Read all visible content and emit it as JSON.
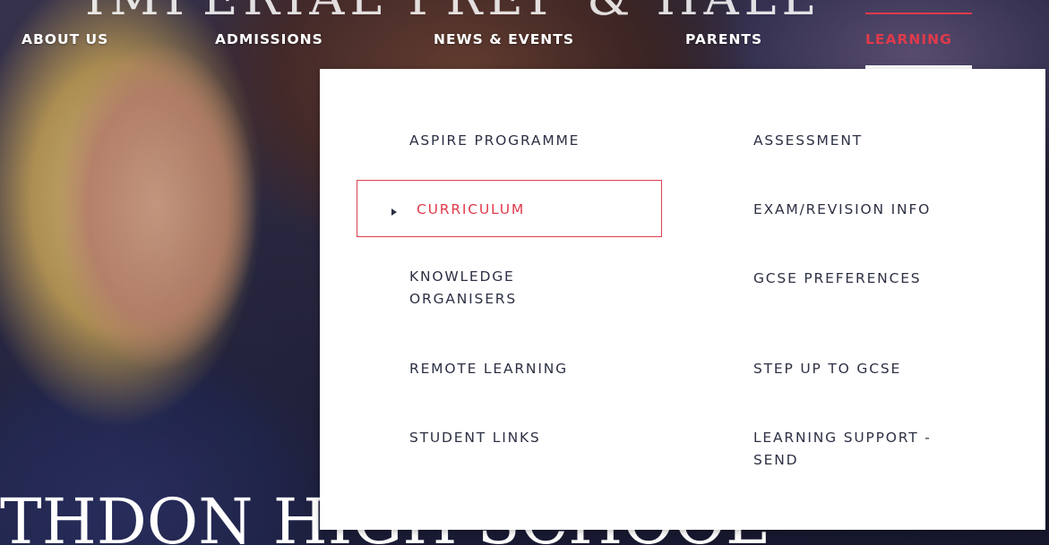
{
  "hero": {
    "title_top": "IMPERIAL PREP & HALL",
    "title_bottom": "THDON HIGH SCHOOL"
  },
  "nav": {
    "items": [
      {
        "label": "ABOUT US"
      },
      {
        "label": "ADMISSIONS"
      },
      {
        "label": "NEWS & EVENTS"
      },
      {
        "label": "PARENTS"
      },
      {
        "label": "LEARNING"
      }
    ],
    "active_item": "LEARNING",
    "accent_color": "#e03a4b"
  },
  "dropdown": {
    "left_column": [
      {
        "label": "ASPIRE PROGRAMME"
      },
      {
        "label": "CURRICULUM"
      },
      {
        "label": "KNOWLEDGE",
        "label2": "ORGANISERS"
      },
      {
        "label": "REMOTE LEARNING"
      },
      {
        "label": "STUDENT LINKS"
      }
    ],
    "right_column": [
      {
        "label": "ASSESSMENT"
      },
      {
        "label": "EXAM/REVISION INFO"
      },
      {
        "label": "GCSE PREFERENCES"
      },
      {
        "label": "STEP UP TO GCSE"
      },
      {
        "label": "LEARNING SUPPORT -",
        "label2": "SEND"
      }
    ],
    "current_item": "CURRICULUM",
    "current_icon": "caret-right-icon"
  }
}
